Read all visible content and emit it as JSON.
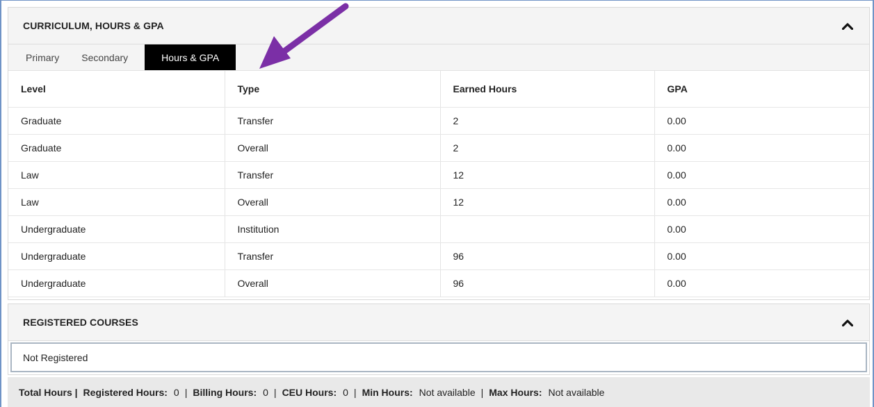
{
  "curriculum": {
    "title": "CURRICULUM, HOURS & GPA",
    "collapse_icon": "chevron-up-icon",
    "tabs": [
      {
        "label": "Primary",
        "active": false
      },
      {
        "label": "Secondary",
        "active": false
      },
      {
        "label": "Hours & GPA",
        "active": true
      }
    ],
    "columns": [
      "Level",
      "Type",
      "Earned Hours",
      "GPA"
    ],
    "rows": [
      [
        "Graduate",
        "Transfer",
        "2",
        "0.00"
      ],
      [
        "Graduate",
        "Overall",
        "2",
        "0.00"
      ],
      [
        "Law",
        "Transfer",
        "12",
        "0.00"
      ],
      [
        "Law",
        "Overall",
        "12",
        "0.00"
      ],
      [
        "Undergraduate",
        "Institution",
        "",
        "0.00"
      ],
      [
        "Undergraduate",
        "Transfer",
        "96",
        "0.00"
      ],
      [
        "Undergraduate",
        "Overall",
        "96",
        "0.00"
      ]
    ]
  },
  "registered": {
    "title": "REGISTERED COURSES",
    "collapse_icon": "chevron-up-icon",
    "message": "Not Registered"
  },
  "footer": {
    "total_hours_label": "Total Hours |",
    "registered_label": "Registered Hours:",
    "registered_value": "0",
    "billing_label": "Billing Hours:",
    "billing_value": "0",
    "ceu_label": "CEU Hours:",
    "ceu_value": "0",
    "min_label": "Min Hours:",
    "min_value": "Not available",
    "max_label": "Max Hours:",
    "max_value": "Not available",
    "separator": "|"
  },
  "annotation": {
    "arrow_color": "#7b2fa6"
  }
}
